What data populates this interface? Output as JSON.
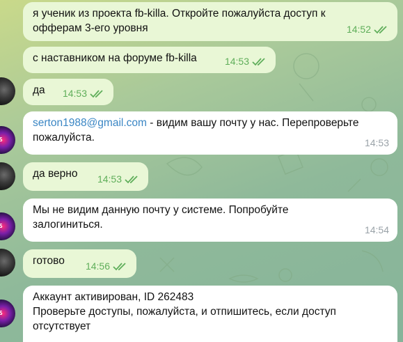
{
  "messages": [
    {
      "text_lines": [
        "я ученик из проекта fb-killa. Откройте пожалуйста доступ к",
        "офферам 3-его уровня"
      ],
      "time": "14:52"
    },
    {
      "text": "с наставником на форуме fb-killa",
      "time": "14:53"
    },
    {
      "text": "да",
      "time": "14:53"
    },
    {
      "email": "serton1988@gmail.com",
      "rest_line1": " - видим вашу почту у нас. Перепроверьте",
      "line2": "пожалуйста.",
      "time": "14:53"
    },
    {
      "text": "да верно",
      "time": "14:53"
    },
    {
      "text_lines": [
        "Мы не видим данную почту у системе. Попробуйте",
        "залогиниться."
      ],
      "time": "14:54"
    },
    {
      "text": "готово",
      "time": "14:56"
    },
    {
      "text_lines": [
        "Аккаунт активирован, ID  262483",
        "Проверьте доступы, пожалуйста, и отпишитесь, если доступ",
        "отсутствует"
      ]
    }
  ],
  "colors": {
    "outgoing_bubble": "#e9f7d6",
    "incoming_bubble": "#ffffff",
    "read_checks": "#5fae5a",
    "link": "#3a86c4"
  },
  "icons": [
    "double-check-icon",
    "avatar-user",
    "avatar-brand"
  ]
}
